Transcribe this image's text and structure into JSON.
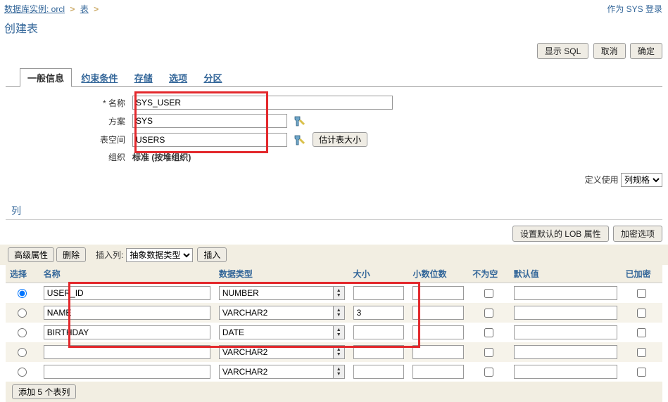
{
  "breadcrumb": {
    "db_instance_label": "数据库实例: orcl",
    "tables_label": "表"
  },
  "login_as": "作为 SYS 登录",
  "page_title": "创建表",
  "actions": {
    "show_sql": "显示 SQL",
    "cancel": "取消",
    "confirm": "确定"
  },
  "tabs": {
    "general": "一般信息",
    "constraints": "约束条件",
    "storage": "存储",
    "options": "选项",
    "partitions": "分区"
  },
  "form": {
    "name_label": "* 名称",
    "name_value": "SYS_USER",
    "schema_label": "方案",
    "schema_value": "SYS",
    "tablespace_label": "表空间",
    "tablespace_value": "USERS",
    "est_size_btn": "估计表大小",
    "org_label": "组织",
    "org_value": "标准 (按堆组织)"
  },
  "define_using": {
    "label": "定义使用",
    "value": "列规格"
  },
  "cols_section_title": "列",
  "cols_actions": {
    "set_default_lob": "设置默认的 LOB 属性",
    "encrypt_options": "加密选项",
    "advanced_props": "高级属性",
    "delete": "删除",
    "insert_col_label": "插入列:",
    "insert_col_type": "抽象数据类型",
    "insert_btn": "插入"
  },
  "table_headers": {
    "select": "选择",
    "name": "名称",
    "datatype": "数据类型",
    "size": "大小",
    "scale": "小数位数",
    "notnull": "不为空",
    "default": "默认值",
    "encrypted": "已加密"
  },
  "rows": [
    {
      "selected": true,
      "name": "USER_ID",
      "datatype": "NUMBER",
      "size": "",
      "scale": "",
      "notnull": false,
      "default": "",
      "encrypted": false
    },
    {
      "selected": false,
      "name": "NAME",
      "datatype": "VARCHAR2",
      "size": "3",
      "scale": "",
      "notnull": false,
      "default": "",
      "encrypted": false
    },
    {
      "selected": false,
      "name": "BIRTHDAY",
      "datatype": "DATE",
      "size": "",
      "scale": "",
      "notnull": false,
      "default": "",
      "encrypted": false
    },
    {
      "selected": false,
      "name": "",
      "datatype": "VARCHAR2",
      "size": "",
      "scale": "",
      "notnull": false,
      "default": "",
      "encrypted": false
    },
    {
      "selected": false,
      "name": "",
      "datatype": "VARCHAR2",
      "size": "",
      "scale": "",
      "notnull": false,
      "default": "",
      "encrypted": false
    }
  ],
  "add_rows_btn": "添加 5 个表列"
}
